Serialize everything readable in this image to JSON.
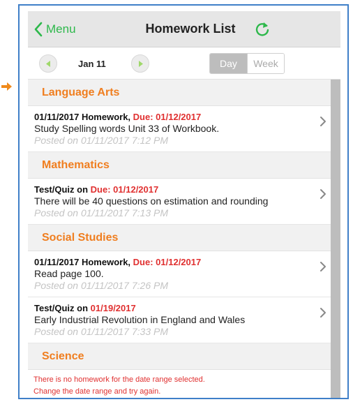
{
  "nav": {
    "back_label": "Menu",
    "title": "Homework List"
  },
  "date_bar": {
    "date": "Jan 11",
    "segments": {
      "day": "Day",
      "week": "Week"
    },
    "selected": "day"
  },
  "sections": [
    {
      "subject": "Language Arts",
      "items": [
        {
          "prefix": "01/11/2017 Homework, ",
          "due": "Due: 01/12/2017",
          "description": "Study Spelling words Unit 33 of Workbook.",
          "posted": "Posted on 01/11/2017 7:12 PM"
        }
      ]
    },
    {
      "subject": "Mathematics",
      "items": [
        {
          "prefix": "Test/Quiz on ",
          "due": "Due: 01/12/2017",
          "description": "There will be 40 questions on estimation and rounding",
          "posted": "Posted on 01/11/2017 7:13 PM"
        }
      ]
    },
    {
      "subject": "Social Studies",
      "items": [
        {
          "prefix": "01/11/2017 Homework, ",
          "due": "Due: 01/12/2017",
          "description": "Read page 100.",
          "posted": "Posted on 01/11/2017 7:26 PM"
        },
        {
          "prefix": "Test/Quiz on ",
          "due": "01/19/2017",
          "description": "Early Industrial Revolution in England and Wales",
          "posted": "Posted on 01/11/2017 7:33 PM"
        }
      ]
    },
    {
      "subject": "Science",
      "empty_message": [
        "There is no homework for the date range selected.",
        "Change the date range and try again."
      ]
    }
  ],
  "colors": {
    "accent_green": "#2db84b",
    "subject_orange": "#f07e1f",
    "due_red": "#e03030",
    "frame_blue": "#3f7fc8"
  },
  "icons": {
    "back": "chevron-left-icon",
    "refresh": "refresh-icon",
    "prev": "triangle-left-icon",
    "next": "triangle-right-icon",
    "row": "chevron-right-icon",
    "pointer": "arrow-right-icon"
  }
}
